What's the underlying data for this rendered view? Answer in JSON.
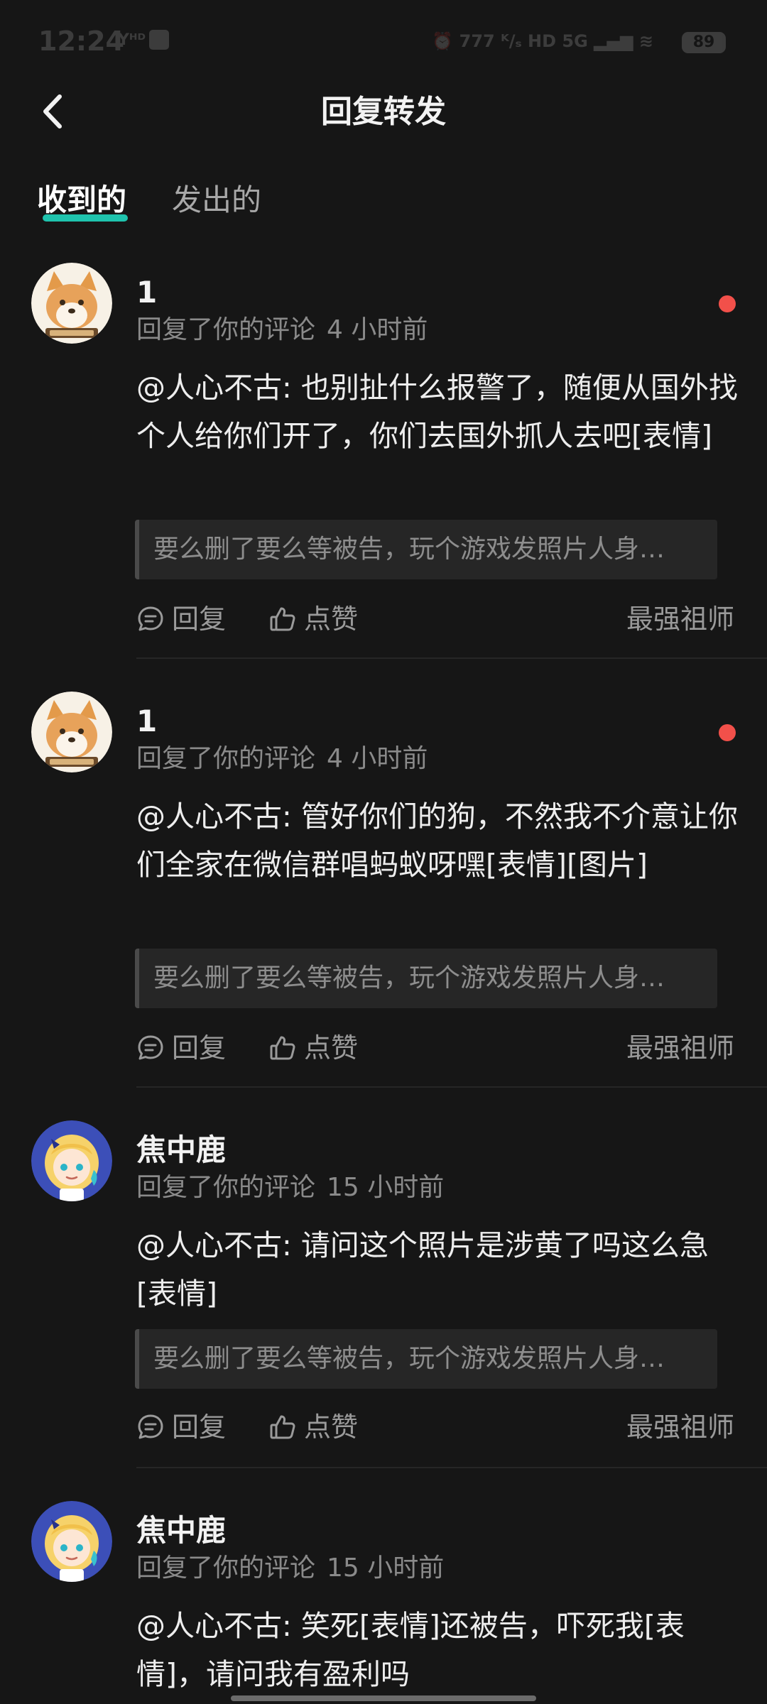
{
  "status_bar": {
    "time": "12:24",
    "app_icons": "Yᴴᴰ",
    "indicators": "⏰ 777 ᴷ/ₛ HD 5G ▂▄▆ ≋",
    "battery": "89"
  },
  "header": {
    "title": "回复转发"
  },
  "tabs": [
    {
      "label": "收到的",
      "active": true
    },
    {
      "label": "发出的",
      "active": false
    }
  ],
  "comments": [
    {
      "username": "1",
      "action_text": "回复了你的评论",
      "time": "4 小时前",
      "unread": true,
      "avatar": "shiba-dog",
      "reply": "@人心不古: 也别扯什么报警了，随便从国外找个人给你们开了，你们去国外抓人去吧[表情]",
      "quote": "要么删了要么等被告，玩个游戏发照片人身…",
      "reply_label": "回复",
      "like_label": "点赞",
      "source": "最强祖师"
    },
    {
      "username": "1",
      "action_text": "回复了你的评论",
      "time": "4 小时前",
      "unread": true,
      "avatar": "shiba-dog",
      "reply": "@人心不古: 管好你们的狗，不然我不介意让你们全家在微信群唱蚂蚁呀嘿[表情][图片]",
      "quote": "要么删了要么等被告，玩个游戏发照片人身…",
      "reply_label": "回复",
      "like_label": "点赞",
      "source": "最强祖师"
    },
    {
      "username": "焦中鹿",
      "action_text": "回复了你的评论",
      "time": "15 小时前",
      "unread": false,
      "avatar": "blonde-girl",
      "reply": "@人心不古: 请问这个照片是涉黄了吗这么急[表情]",
      "quote": "要么删了要么等被告，玩个游戏发照片人身…",
      "reply_label": "回复",
      "like_label": "点赞",
      "source": "最强祖师"
    },
    {
      "username": "焦中鹿",
      "action_text": "回复了你的评论",
      "time": "15 小时前",
      "unread": false,
      "avatar": "blonde-girl",
      "reply": "@人心不古: 笑死[表情]还被告，吓死我[表情]，请问我有盈利吗"
    }
  ],
  "colors": {
    "background": "#161616",
    "tab_indicator": "#1fc3ad",
    "unread_dot": "#f2504a"
  }
}
